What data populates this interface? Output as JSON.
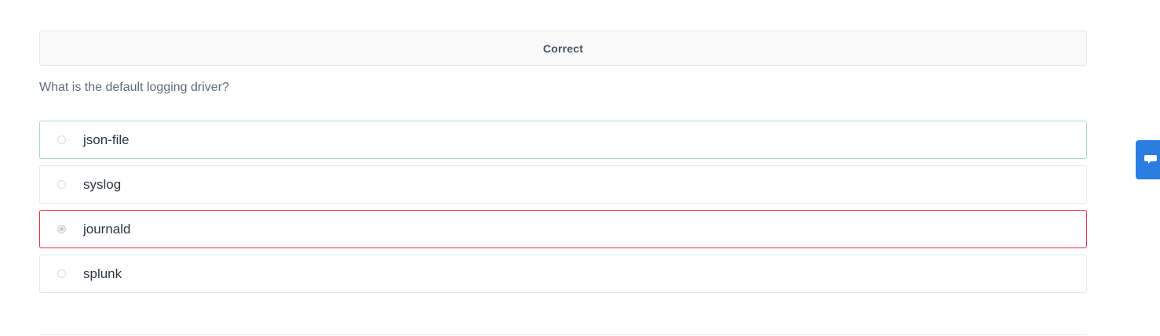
{
  "status": {
    "text": "Correct"
  },
  "question": {
    "text": "What is the default logging driver?"
  },
  "options": [
    {
      "label": "json-file",
      "state": "correct",
      "selected": false
    },
    {
      "label": "syslog",
      "state": "neutral",
      "selected": false
    },
    {
      "label": "journald",
      "state": "wrong",
      "selected": true
    },
    {
      "label": "splunk",
      "state": "neutral",
      "selected": false
    }
  ],
  "colors": {
    "correct_border": "#a7d8c8",
    "wrong_border": "#dc3545",
    "feedback_tab": "#2a7de1"
  },
  "feedback": {
    "icon": "speech-bubble-icon"
  }
}
